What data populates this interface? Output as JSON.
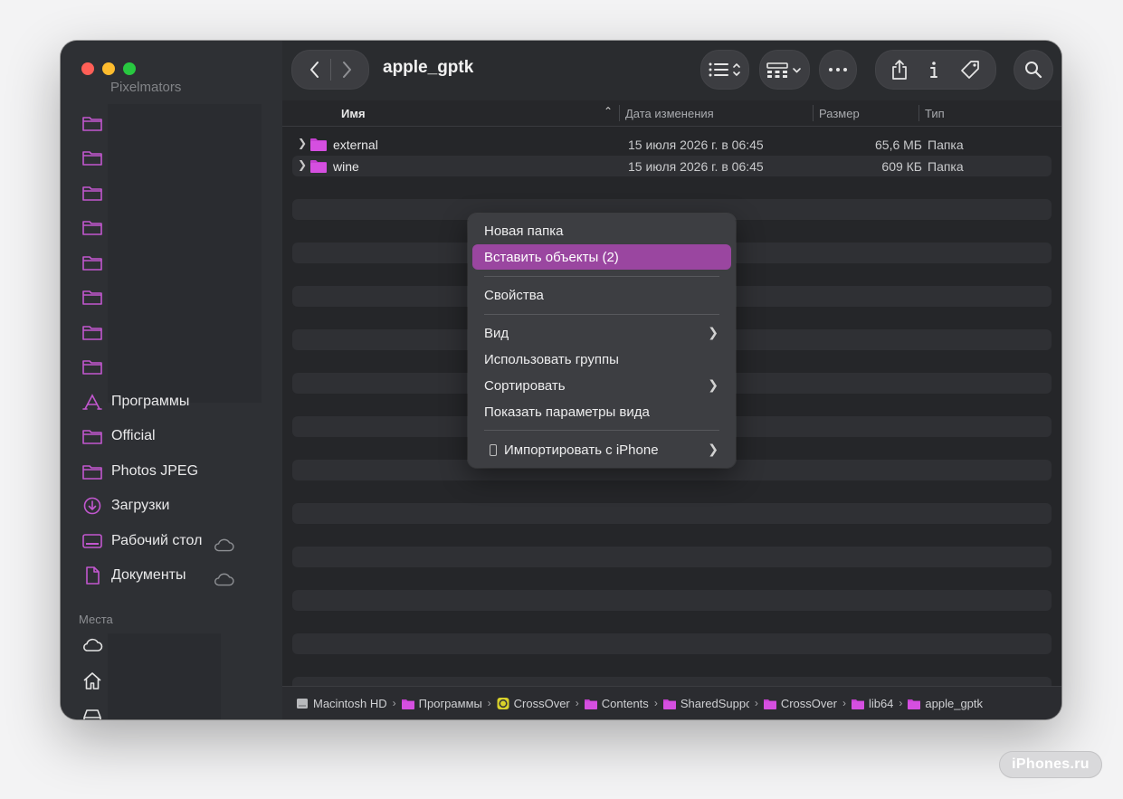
{
  "window": {
    "title": "apple_gptk"
  },
  "sidebar": {
    "ghost_label": "Pixelmators",
    "favorites": [
      {
        "label": "Программы",
        "icon": "apps-icon",
        "cloud": false
      },
      {
        "label": "Official",
        "icon": "folder-icon",
        "cloud": false
      },
      {
        "label": "Photos JPEG",
        "icon": "folder-icon",
        "cloud": false
      },
      {
        "label": "Загрузки",
        "icon": "download-icon",
        "cloud": false
      },
      {
        "label": "Рабочий стол",
        "icon": "desktop-icon",
        "cloud": true
      },
      {
        "label": "Документы",
        "icon": "document-icon",
        "cloud": true
      }
    ],
    "places_title": "Места",
    "places": [
      {
        "icon": "icloud-icon"
      },
      {
        "icon": "home-icon"
      },
      {
        "icon": "drive-icon"
      }
    ]
  },
  "columns": {
    "name": "Имя",
    "date": "Дата изменения",
    "size": "Размер",
    "type": "Тип"
  },
  "files": [
    {
      "name": "external",
      "date": "15 июля 2026 г. в 06:45",
      "size": "65,6 МБ",
      "type": "Папка"
    },
    {
      "name": "wine",
      "date": "15 июля 2026 г. в 06:45",
      "size": "609 КБ",
      "type": "Папка"
    }
  ],
  "context_menu": {
    "new_folder": "Новая папка",
    "paste": "Вставить объекты (2)",
    "properties": "Свойства",
    "view": "Вид",
    "use_groups": "Использовать группы",
    "sort": "Сортировать",
    "show_view_options": "Показать параметры вида",
    "import_iphone": "Импортировать с iPhone"
  },
  "path": [
    {
      "label": "Macintosh HD",
      "icon": "disk-icon"
    },
    {
      "label": "Программы",
      "icon": "folder-icon"
    },
    {
      "label": "CrossOver",
      "icon": "crossover-app-icon"
    },
    {
      "label": "Contents",
      "icon": "folder-icon"
    },
    {
      "label": "SharedSupport",
      "icon": "folder-icon"
    },
    {
      "label": "CrossOver",
      "icon": "folder-icon"
    },
    {
      "label": "lib64",
      "icon": "folder-icon"
    },
    {
      "label": "apple_gptk",
      "icon": "folder-icon"
    }
  ],
  "watermark": "iPhones.ru",
  "colors": {
    "accent": "#9a46a0",
    "folder": "#c53fd0",
    "sidebar_icon": "#c257cf"
  }
}
